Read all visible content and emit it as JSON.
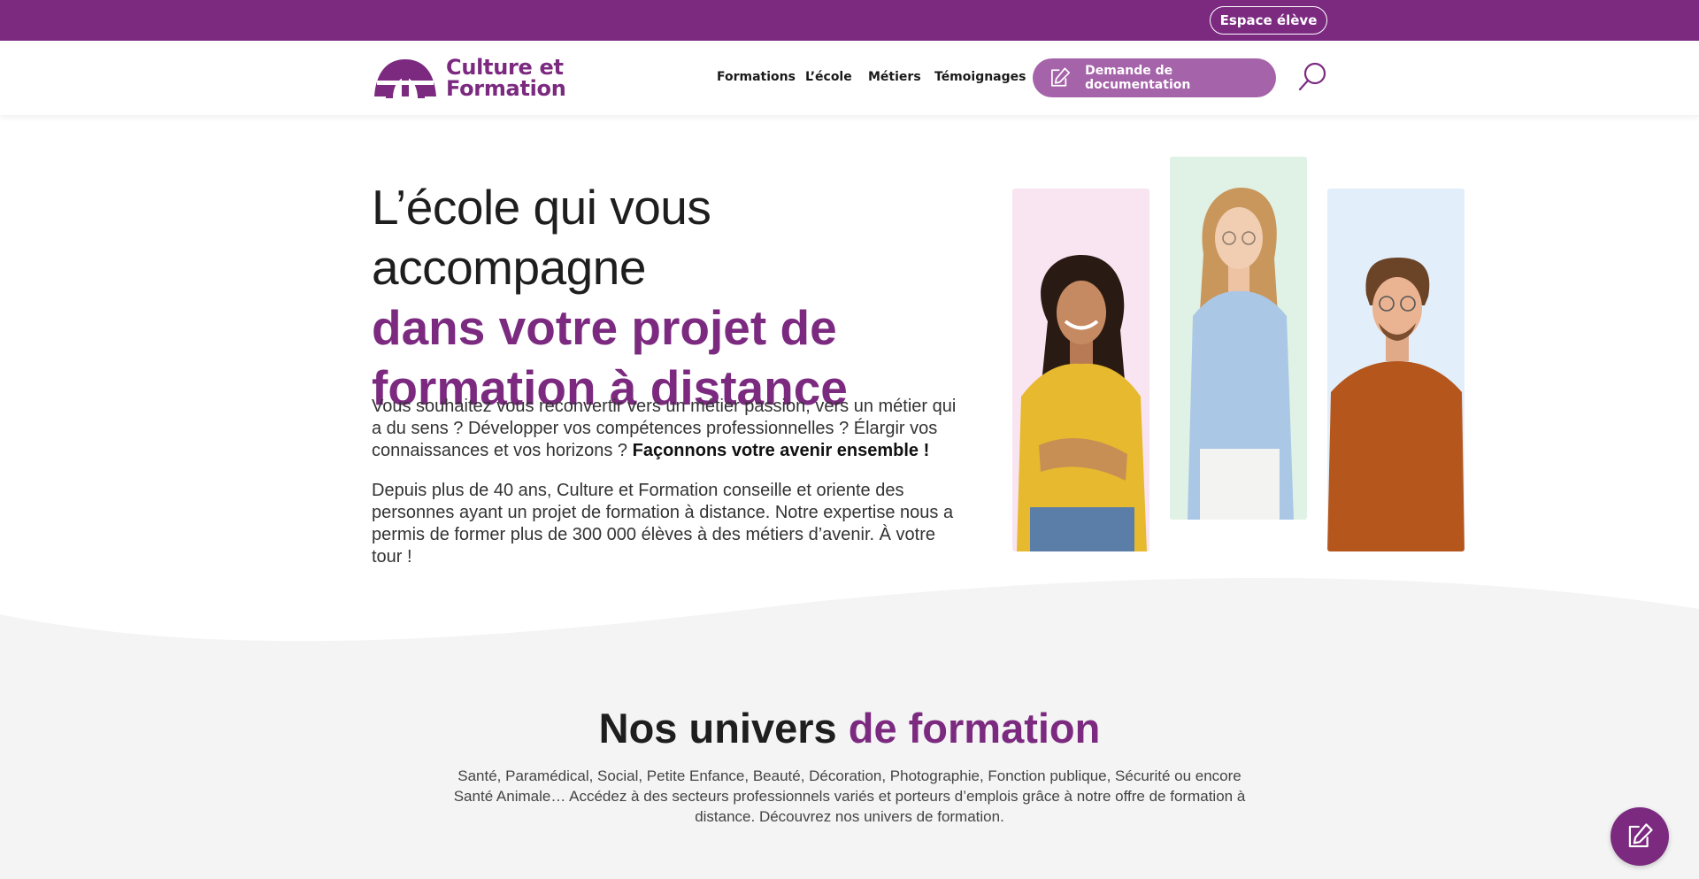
{
  "topbar": {
    "espace_eleve": "Espace élève"
  },
  "header": {
    "logo": {
      "line1": "Culture et",
      "line2": "Formation"
    },
    "nav": [
      "Formations",
      "L’école",
      "Métiers",
      "Témoignages"
    ],
    "doc_button": "Demande de documentation"
  },
  "hero": {
    "title_line1": "L’école qui vous accompagne",
    "title_line2": "dans votre projet de",
    "title_line3": "formation à distance",
    "p1_text": "Vous souhaitez vous reconvertir vers un métier passion, vers un métier qui a du sens ? Développer vos compétences professionnelles ? Élargir vos connaissances et vos horizons ? ",
    "p1_bold": "Façonnons votre avenir ensemble !",
    "p2": "Depuis plus de 40 ans, Culture et Formation conseille et oriente des personnes ayant un projet de formation à distance. Notre expertise nous a permis de former plus de 300 000 élèves à des métiers d’avenir. À votre tour !"
  },
  "univers": {
    "title_normal": "Nos univers ",
    "title_bold": "de formation",
    "description": "Santé, Paramédical, Social, Petite Enfance, Beauté, Décoration, Photographie, Fonction publique, Sécurité ou encore Santé Animale… Accédez à des secteurs professionnels variés et porteurs d’emplois grâce à notre offre de formation à distance. Découvrez nos univers de formation."
  },
  "colors": {
    "brand": "#7b2a80",
    "button": "#a563a9",
    "photo_bg_pink": "#f9e4f1",
    "photo_bg_green": "#dff2e5",
    "photo_bg_blue": "#e2eefa",
    "section_bg": "#f4f4f4"
  },
  "icons": [
    "logo-icon",
    "edit-icon",
    "search-icon"
  ]
}
